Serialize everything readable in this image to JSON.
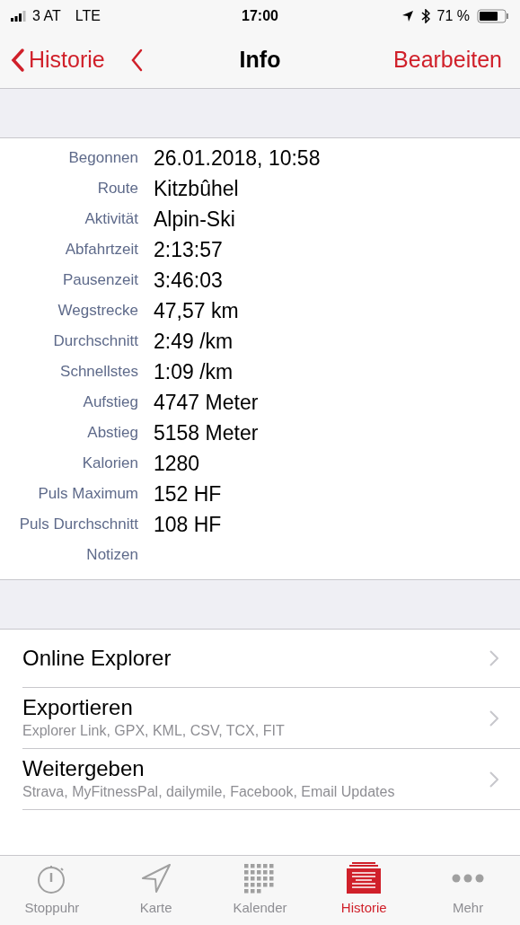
{
  "status_bar": {
    "carrier": "3 AT",
    "network": "LTE",
    "time": "17:00",
    "battery": "71 %"
  },
  "nav": {
    "back": "Historie",
    "title": "Info",
    "action": "Bearbeiten"
  },
  "details": [
    {
      "label": "Begonnen",
      "value": "26.01.2018, 10:58"
    },
    {
      "label": "Route",
      "value": "Kitzbûhel"
    },
    {
      "label": "Aktivität",
      "value": "Alpin-Ski"
    },
    {
      "label": "Abfahrtzeit",
      "value": "2:13:57"
    },
    {
      "label": "Pausenzeit",
      "value": "3:46:03"
    },
    {
      "label": "Wegstrecke",
      "value": "47,57 km"
    },
    {
      "label": "Durchschnitt",
      "value": "2:49 /km"
    },
    {
      "label": "Schnellstes",
      "value": "1:09 /km"
    },
    {
      "label": "Aufstieg",
      "value": "4747 Meter"
    },
    {
      "label": "Abstieg",
      "value": "5158 Meter"
    },
    {
      "label": "Kalorien",
      "value": "1280"
    },
    {
      "label": "Puls Maximum",
      "value": "152 HF"
    },
    {
      "label": "Puls Durchschnitt",
      "value": "108 HF"
    },
    {
      "label": "Notizen"
    }
  ],
  "actions": [
    {
      "title": "Online Explorer"
    },
    {
      "title": "Exportieren",
      "subtitle": "Explorer Link, GPX, KML, CSV, TCX, FIT"
    },
    {
      "title": "Weitergeben",
      "subtitle": "Strava, MyFitnessPal, dailymile, Facebook, Email Updates"
    }
  ],
  "tab_bar": [
    {
      "kind": "stopwatch",
      "label": "Stoppuhr",
      "selected": false
    },
    {
      "kind": "map",
      "label": "Karte",
      "selected": false
    },
    {
      "kind": "calendar",
      "label": "Kalender",
      "selected": false
    },
    {
      "kind": "history",
      "label": "Historie",
      "selected": true
    },
    {
      "kind": "more",
      "label": "Mehr",
      "selected": false
    }
  ]
}
